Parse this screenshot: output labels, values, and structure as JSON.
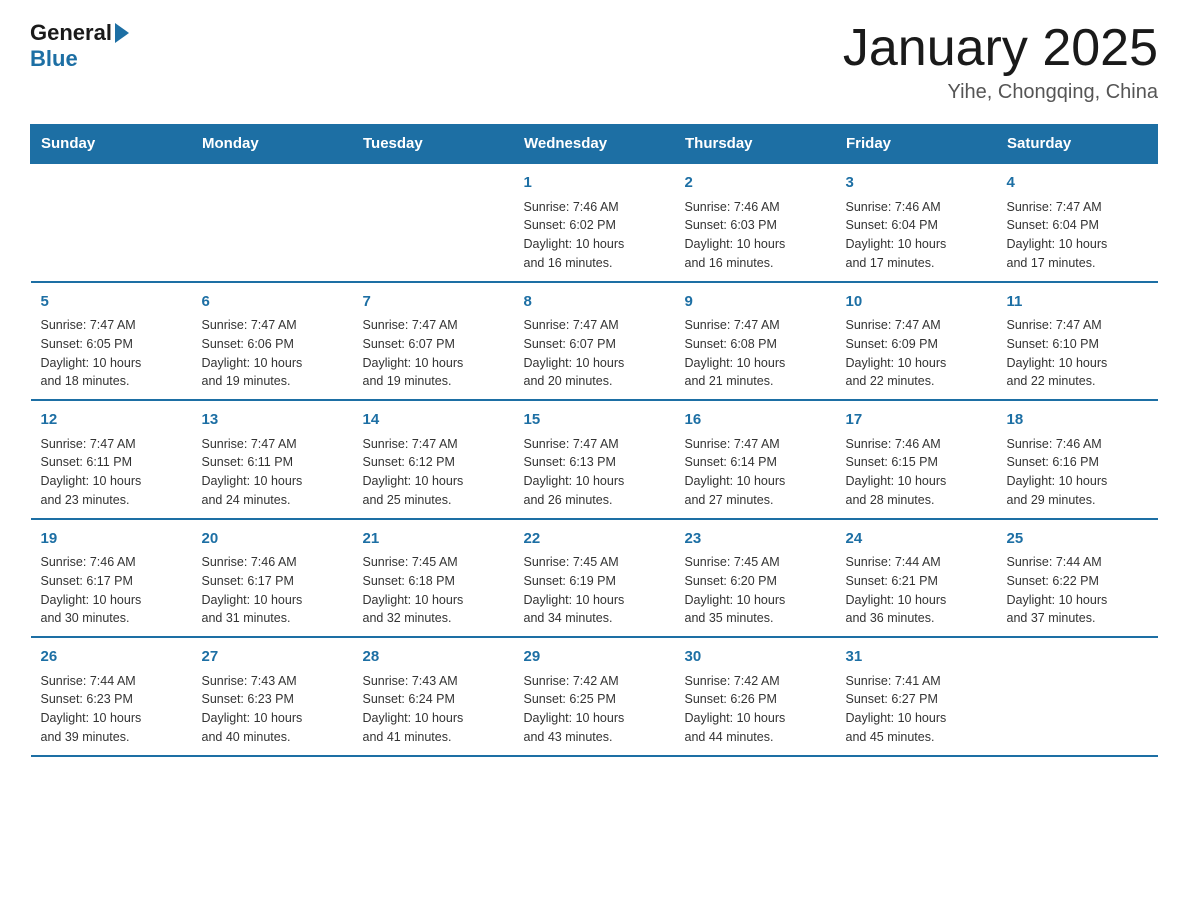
{
  "header": {
    "logo_general": "General",
    "logo_blue": "Blue",
    "title": "January 2025",
    "subtitle": "Yihe, Chongqing, China"
  },
  "calendar": {
    "days_of_week": [
      "Sunday",
      "Monday",
      "Tuesday",
      "Wednesday",
      "Thursday",
      "Friday",
      "Saturday"
    ],
    "weeks": [
      [
        {
          "day": "",
          "info": ""
        },
        {
          "day": "",
          "info": ""
        },
        {
          "day": "",
          "info": ""
        },
        {
          "day": "1",
          "info": "Sunrise: 7:46 AM\nSunset: 6:02 PM\nDaylight: 10 hours\nand 16 minutes."
        },
        {
          "day": "2",
          "info": "Sunrise: 7:46 AM\nSunset: 6:03 PM\nDaylight: 10 hours\nand 16 minutes."
        },
        {
          "day": "3",
          "info": "Sunrise: 7:46 AM\nSunset: 6:04 PM\nDaylight: 10 hours\nand 17 minutes."
        },
        {
          "day": "4",
          "info": "Sunrise: 7:47 AM\nSunset: 6:04 PM\nDaylight: 10 hours\nand 17 minutes."
        }
      ],
      [
        {
          "day": "5",
          "info": "Sunrise: 7:47 AM\nSunset: 6:05 PM\nDaylight: 10 hours\nand 18 minutes."
        },
        {
          "day": "6",
          "info": "Sunrise: 7:47 AM\nSunset: 6:06 PM\nDaylight: 10 hours\nand 19 minutes."
        },
        {
          "day": "7",
          "info": "Sunrise: 7:47 AM\nSunset: 6:07 PM\nDaylight: 10 hours\nand 19 minutes."
        },
        {
          "day": "8",
          "info": "Sunrise: 7:47 AM\nSunset: 6:07 PM\nDaylight: 10 hours\nand 20 minutes."
        },
        {
          "day": "9",
          "info": "Sunrise: 7:47 AM\nSunset: 6:08 PM\nDaylight: 10 hours\nand 21 minutes."
        },
        {
          "day": "10",
          "info": "Sunrise: 7:47 AM\nSunset: 6:09 PM\nDaylight: 10 hours\nand 22 minutes."
        },
        {
          "day": "11",
          "info": "Sunrise: 7:47 AM\nSunset: 6:10 PM\nDaylight: 10 hours\nand 22 minutes."
        }
      ],
      [
        {
          "day": "12",
          "info": "Sunrise: 7:47 AM\nSunset: 6:11 PM\nDaylight: 10 hours\nand 23 minutes."
        },
        {
          "day": "13",
          "info": "Sunrise: 7:47 AM\nSunset: 6:11 PM\nDaylight: 10 hours\nand 24 minutes."
        },
        {
          "day": "14",
          "info": "Sunrise: 7:47 AM\nSunset: 6:12 PM\nDaylight: 10 hours\nand 25 minutes."
        },
        {
          "day": "15",
          "info": "Sunrise: 7:47 AM\nSunset: 6:13 PM\nDaylight: 10 hours\nand 26 minutes."
        },
        {
          "day": "16",
          "info": "Sunrise: 7:47 AM\nSunset: 6:14 PM\nDaylight: 10 hours\nand 27 minutes."
        },
        {
          "day": "17",
          "info": "Sunrise: 7:46 AM\nSunset: 6:15 PM\nDaylight: 10 hours\nand 28 minutes."
        },
        {
          "day": "18",
          "info": "Sunrise: 7:46 AM\nSunset: 6:16 PM\nDaylight: 10 hours\nand 29 minutes."
        }
      ],
      [
        {
          "day": "19",
          "info": "Sunrise: 7:46 AM\nSunset: 6:17 PM\nDaylight: 10 hours\nand 30 minutes."
        },
        {
          "day": "20",
          "info": "Sunrise: 7:46 AM\nSunset: 6:17 PM\nDaylight: 10 hours\nand 31 minutes."
        },
        {
          "day": "21",
          "info": "Sunrise: 7:45 AM\nSunset: 6:18 PM\nDaylight: 10 hours\nand 32 minutes."
        },
        {
          "day": "22",
          "info": "Sunrise: 7:45 AM\nSunset: 6:19 PM\nDaylight: 10 hours\nand 34 minutes."
        },
        {
          "day": "23",
          "info": "Sunrise: 7:45 AM\nSunset: 6:20 PM\nDaylight: 10 hours\nand 35 minutes."
        },
        {
          "day": "24",
          "info": "Sunrise: 7:44 AM\nSunset: 6:21 PM\nDaylight: 10 hours\nand 36 minutes."
        },
        {
          "day": "25",
          "info": "Sunrise: 7:44 AM\nSunset: 6:22 PM\nDaylight: 10 hours\nand 37 minutes."
        }
      ],
      [
        {
          "day": "26",
          "info": "Sunrise: 7:44 AM\nSunset: 6:23 PM\nDaylight: 10 hours\nand 39 minutes."
        },
        {
          "day": "27",
          "info": "Sunrise: 7:43 AM\nSunset: 6:23 PM\nDaylight: 10 hours\nand 40 minutes."
        },
        {
          "day": "28",
          "info": "Sunrise: 7:43 AM\nSunset: 6:24 PM\nDaylight: 10 hours\nand 41 minutes."
        },
        {
          "day": "29",
          "info": "Sunrise: 7:42 AM\nSunset: 6:25 PM\nDaylight: 10 hours\nand 43 minutes."
        },
        {
          "day": "30",
          "info": "Sunrise: 7:42 AM\nSunset: 6:26 PM\nDaylight: 10 hours\nand 44 minutes."
        },
        {
          "day": "31",
          "info": "Sunrise: 7:41 AM\nSunset: 6:27 PM\nDaylight: 10 hours\nand 45 minutes."
        },
        {
          "day": "",
          "info": ""
        }
      ]
    ]
  }
}
